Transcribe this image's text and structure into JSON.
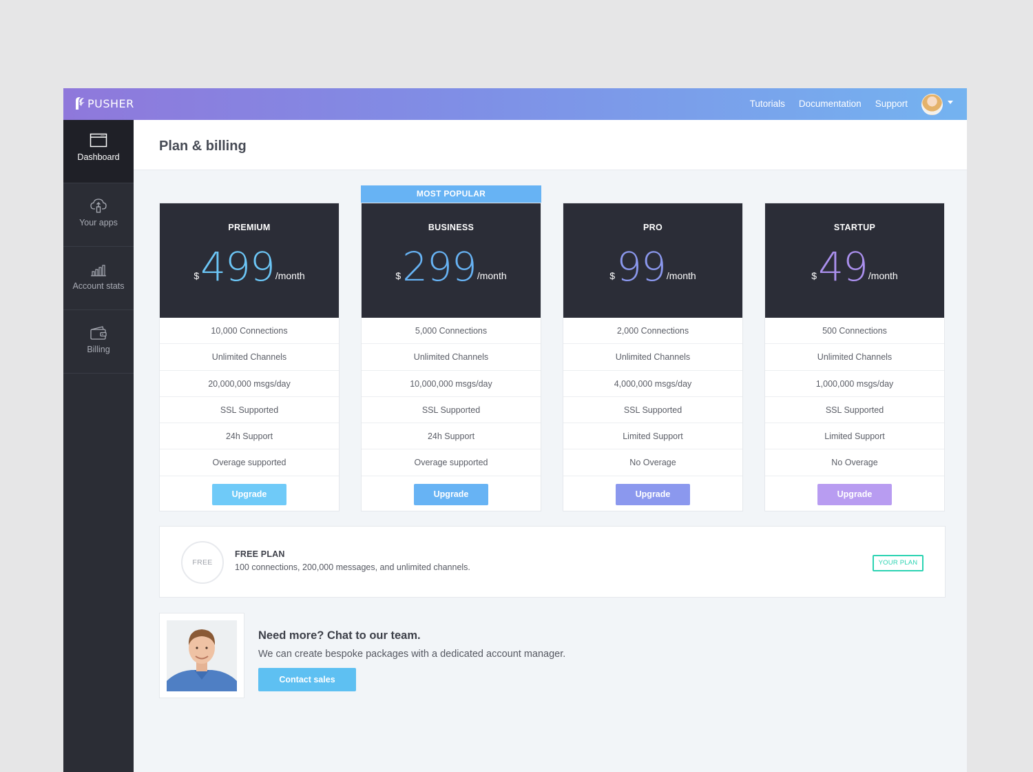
{
  "brand": {
    "name": "PUSHER"
  },
  "topnav": [
    {
      "label": "Tutorials"
    },
    {
      "label": "Documentation"
    },
    {
      "label": "Support"
    }
  ],
  "sidebar": {
    "items": [
      {
        "label": "Dashboard",
        "icon": "browser-window-icon",
        "active": true
      },
      {
        "label": "Your apps",
        "icon": "cloud-upload-icon"
      },
      {
        "label": "Account stats",
        "icon": "bar-chart-icon"
      },
      {
        "label": "Billing",
        "icon": "wallet-icon"
      }
    ]
  },
  "page": {
    "title": "Plan & billing"
  },
  "popular_badge": "MOST POPULAR",
  "plans": [
    {
      "name": "PREMIUM",
      "currency": "$",
      "price": "499",
      "period": "/month",
      "price_color": "#6cc6f6",
      "features": [
        "10,000 Connections",
        "Unlimited Channels",
        "20,000,000 msgs/day",
        "SSL Supported",
        "24h Support",
        "Overage supported"
      ],
      "button": "Upgrade",
      "button_color": "#6fcaf8"
    },
    {
      "name": "BUSINESS",
      "currency": "$",
      "price": "299",
      "period": "/month",
      "price_color": "#67b3f4",
      "features": [
        "5,000 Connections",
        "Unlimited Channels",
        "10,000,000 msgs/day",
        "SSL Supported",
        "24h Support",
        "Overage supported"
      ],
      "button": "Upgrade",
      "button_color": "#67b3f4"
    },
    {
      "name": "PRO",
      "currency": "$",
      "price": "99",
      "period": "/month",
      "price_color": "#8b98ee",
      "features": [
        "2,000 Connections",
        "Unlimited Channels",
        "4,000,000 msgs/day",
        "SSL Supported",
        "Limited Support",
        "No Overage"
      ],
      "button": "Upgrade",
      "button_color": "#8b98ee"
    },
    {
      "name": "STARTUP",
      "currency": "$",
      "price": "49",
      "period": "/month",
      "price_color": "#ab90ee",
      "features": [
        "500 Connections",
        "Unlimited Channels",
        "1,000,000 msgs/day",
        "SSL Supported",
        "Limited Support",
        "No Overage"
      ],
      "button": "Upgrade",
      "button_color": "#b89cf1"
    }
  ],
  "free_plan": {
    "badge": "FREE",
    "title": "FREE PLAN",
    "description": "100 connections, 200,000 messages, and unlimited channels.",
    "status": "YOUR PLAN",
    "status_color": "#2bd3b2"
  },
  "contact": {
    "title": "Need more? Chat to our team.",
    "description": "We can create bespoke packages with a dedicated account manager.",
    "button": "Contact sales"
  }
}
